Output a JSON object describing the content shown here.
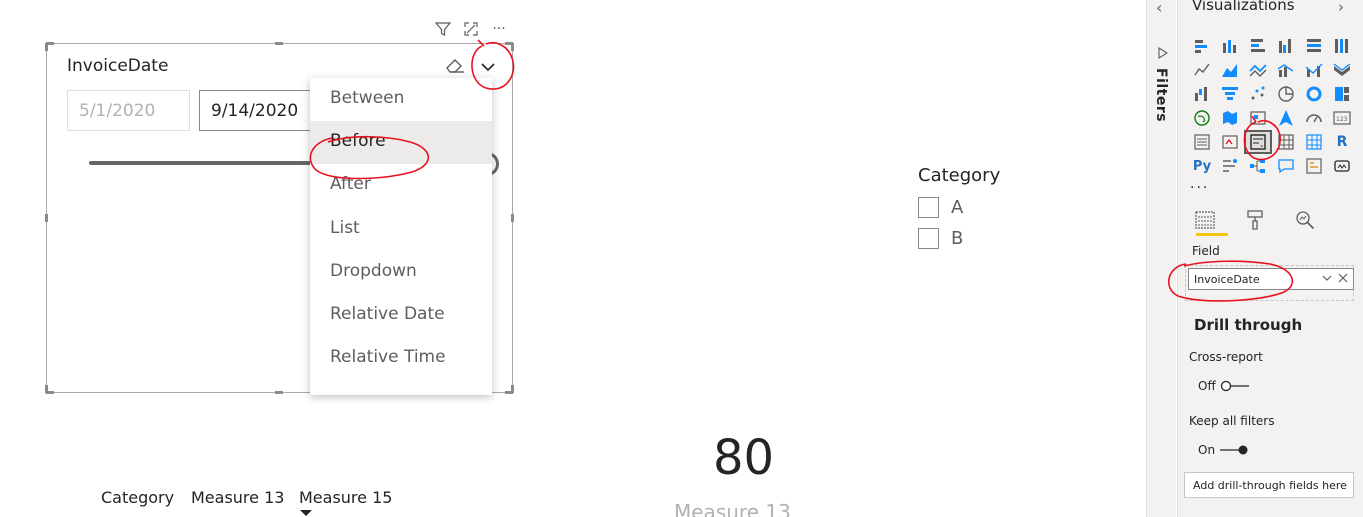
{
  "slicer": {
    "title": "InvoiceDate",
    "start_date": "5/1/2020",
    "end_date": "9/14/2020",
    "dropdown": {
      "items": [
        "Between",
        "Before",
        "After",
        "List",
        "Dropdown",
        "Relative Date",
        "Relative Time"
      ],
      "selected": "Before"
    }
  },
  "visual_header": {
    "icons": [
      "filter-icon",
      "focus-mode-icon",
      "more-options-icon"
    ],
    "more_label": "···"
  },
  "category_slicer": {
    "title": "Category",
    "options": [
      "A",
      "B"
    ]
  },
  "card": {
    "value": "80",
    "label": "Measure 13"
  },
  "table": {
    "headers": [
      "Category",
      "Measure 13",
      "Measure 15"
    ]
  },
  "filters_pane": {
    "label": "Filters",
    "collapse_glyph": "‹"
  },
  "viz_pane": {
    "title": "Visualizations",
    "expand_glyph": "›",
    "more": "...",
    "field_label": "Field",
    "field_value": "InvoiceDate",
    "drill_through_title": "Drill through",
    "cross_report_label": "Cross-report",
    "cross_report_state": "Off",
    "keep_filters_label": "Keep all filters",
    "keep_filters_state": "On",
    "add_drill_button": "Add drill-through fields here",
    "python_label": "Py",
    "r_label": "R"
  },
  "colors": {
    "annotation_red": "#e81123",
    "accent_yellow": "#f2c811",
    "text_primary": "#252423",
    "text_secondary": "#605e5c"
  }
}
